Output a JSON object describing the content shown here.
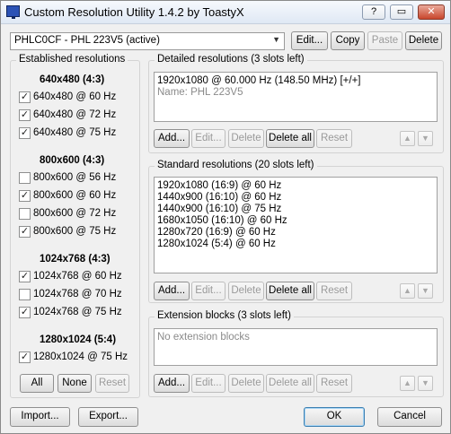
{
  "window": {
    "title": "Custom Resolution Utility 1.4.2 by ToastyX"
  },
  "titlebar": {
    "help": "?",
    "minimize": "▭",
    "close": "✕"
  },
  "monitor": {
    "selected": "PHLC0CF - PHL 223V5 (active)"
  },
  "monitor_buttons": {
    "edit": "Edit...",
    "copy": "Copy",
    "paste": "Paste",
    "delete": "Delete"
  },
  "established": {
    "title": "Established resolutions",
    "groups": [
      {
        "heading": "640x480 (4:3)",
        "items": [
          {
            "label": "640x480 @ 60 Hz",
            "checked": true
          },
          {
            "label": "640x480 @ 72 Hz",
            "checked": true
          },
          {
            "label": "640x480 @ 75 Hz",
            "checked": true
          }
        ]
      },
      {
        "heading": "800x600 (4:3)",
        "items": [
          {
            "label": "800x600 @ 56 Hz",
            "checked": false
          },
          {
            "label": "800x600 @ 60 Hz",
            "checked": true
          },
          {
            "label": "800x600 @ 72 Hz",
            "checked": false
          },
          {
            "label": "800x600 @ 75 Hz",
            "checked": true
          }
        ]
      },
      {
        "heading": "1024x768 (4:3)",
        "items": [
          {
            "label": "1024x768 @ 60 Hz",
            "checked": true
          },
          {
            "label": "1024x768 @ 70 Hz",
            "checked": false
          },
          {
            "label": "1024x768 @ 75 Hz",
            "checked": true
          }
        ]
      },
      {
        "heading": "1280x1024 (5:4)",
        "items": [
          {
            "label": "1280x1024 @ 75 Hz",
            "checked": true
          }
        ]
      }
    ],
    "buttons": {
      "all": "All",
      "none": "None",
      "reset": "Reset"
    }
  },
  "detailed": {
    "title": "Detailed resolutions (3 slots left)",
    "line1": "1920x1080 @ 60.000 Hz (148.50 MHz) [+/+]",
    "line2": "Name: PHL 223V5",
    "buttons": {
      "add": "Add...",
      "edit": "Edit...",
      "delete": "Delete",
      "delete_all": "Delete all",
      "reset": "Reset"
    }
  },
  "standard": {
    "title": "Standard resolutions (20 slots left)",
    "items": [
      "1920x1080 (16:9) @ 60 Hz",
      "1440x900 (16:10) @ 60 Hz",
      "1440x900 (16:10) @ 75 Hz",
      "1680x1050 (16:10) @ 60 Hz",
      "1280x720 (16:9) @ 60 Hz",
      "1280x1024 (5:4) @ 60 Hz"
    ],
    "buttons": {
      "add": "Add...",
      "edit": "Edit...",
      "delete": "Delete",
      "delete_all": "Delete all",
      "reset": "Reset"
    }
  },
  "extension": {
    "title": "Extension blocks (3 slots left)",
    "empty_text": "No extension blocks",
    "buttons": {
      "add": "Add...",
      "edit": "Edit...",
      "delete": "Delete",
      "delete_all": "Delete all",
      "reset": "Reset"
    }
  },
  "footer": {
    "import": "Import...",
    "export": "Export...",
    "ok": "OK",
    "cancel": "Cancel"
  },
  "icons": {
    "up": "▲",
    "down": "▼",
    "check": "✓",
    "dropdown": "▼"
  }
}
